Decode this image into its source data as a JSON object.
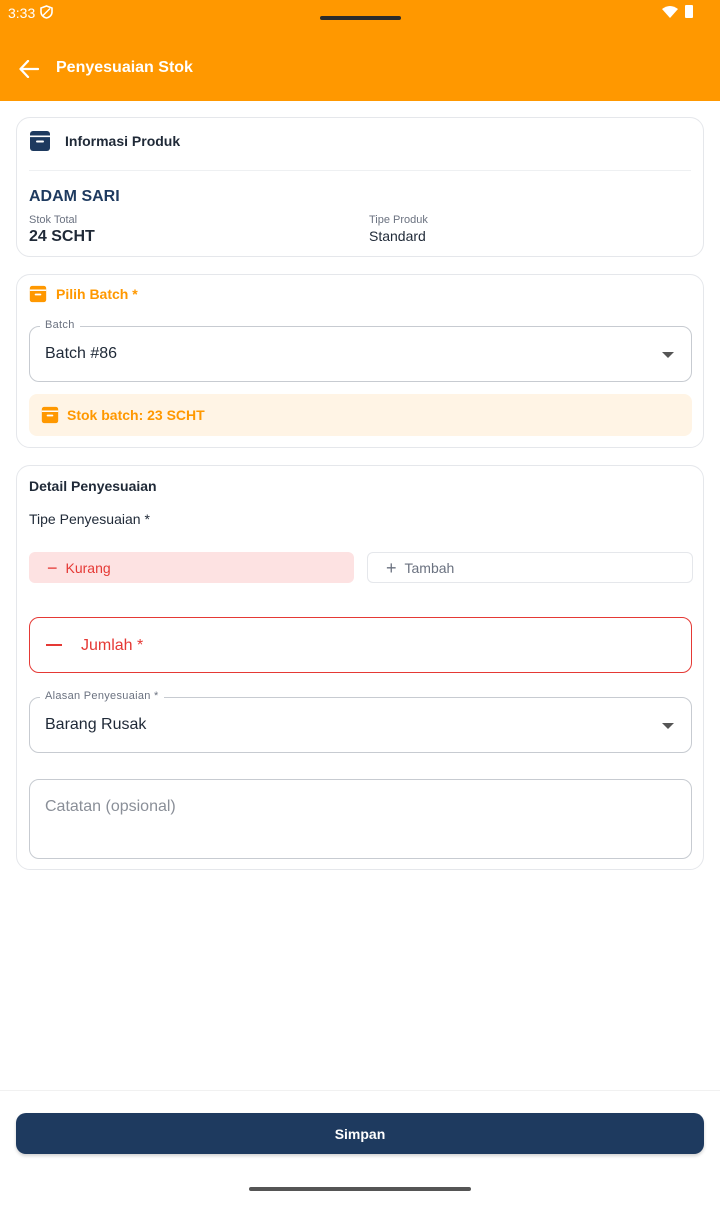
{
  "statusbar": {
    "time": "3:33"
  },
  "appbar": {
    "title": "Penyesuaian Stok"
  },
  "product": {
    "section_title": "Informasi Produk",
    "name": "ADAM SARI",
    "total_label": "Stok Total",
    "total_value": "24 SCHT",
    "type_label": "Tipe Produk",
    "type_value": "Standard"
  },
  "batch": {
    "section_title": "Pilih Batch *",
    "field_label": "Batch",
    "selected": "Batch #86",
    "info": "Stok batch: 23 SCHT"
  },
  "detail": {
    "section_title": "Detail Penyesuaian",
    "type_label": "Tipe Penyesuaian *",
    "option_minus": "Kurang",
    "option_plus": "Tambah",
    "amount_placeholder": "Jumlah *",
    "reason_label": "Alasan Penyesuaian *",
    "reason_value": "Barang Rusak",
    "note_placeholder": "Catatan (opsional)"
  },
  "actions": {
    "save": "Simpan"
  },
  "colors": {
    "primary": "#ff9800",
    "navy": "#1e3a5f",
    "danger": "#e53935",
    "danger_bg": "#fde2e2",
    "warning_bg": "#fff4e5"
  }
}
